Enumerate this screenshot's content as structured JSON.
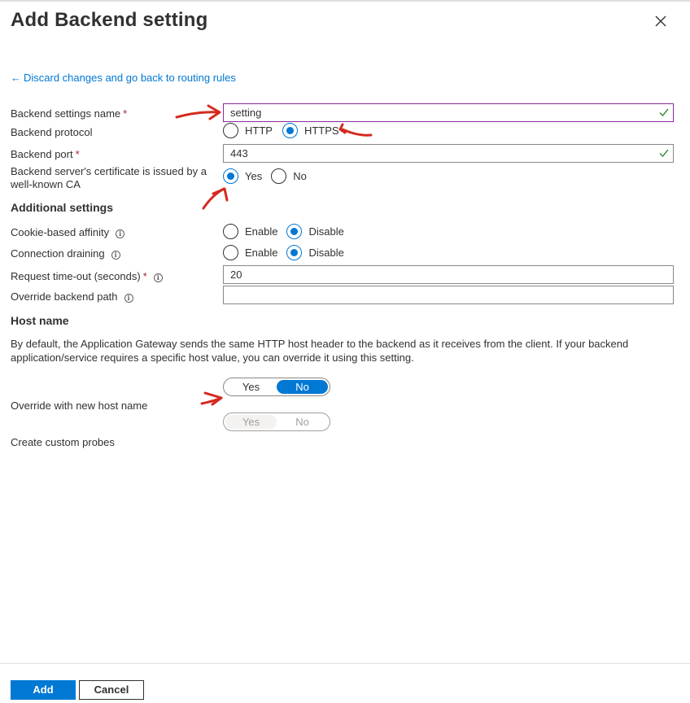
{
  "dialog": {
    "title": "Add Backend setting",
    "close_icon": "close-icon"
  },
  "back_link": {
    "arrow": "←",
    "label": "Discard changes and go back to routing rules"
  },
  "form": {
    "settings_name": {
      "label": "Backend settings name",
      "required": "*",
      "value": "setting",
      "valid": true
    },
    "protocol": {
      "label": "Backend protocol",
      "options": [
        "HTTP",
        "HTTPS"
      ],
      "selected": "HTTPS"
    },
    "port": {
      "label": "Backend port",
      "required": "*",
      "value": "443",
      "valid": true
    },
    "well_known_ca": {
      "label": "Backend server's certificate is issued by a well-known CA",
      "options": [
        "Yes",
        "No"
      ],
      "selected": "Yes"
    }
  },
  "additional": {
    "heading": "Additional settings",
    "cookie_affinity": {
      "label": "Cookie-based affinity",
      "options": [
        "Enable",
        "Disable"
      ],
      "selected": "Disable"
    },
    "connection_draining": {
      "label": "Connection draining",
      "options": [
        "Enable",
        "Disable"
      ],
      "selected": "Disable"
    },
    "timeout": {
      "label": "Request time-out (seconds)",
      "required": "*",
      "value": "20"
    },
    "override_path": {
      "label": "Override backend path",
      "value": ""
    }
  },
  "host": {
    "heading": "Host name",
    "description": "By default, the Application Gateway sends the same HTTP host header to the backend as it receives from the client. If your backend application/service requires a specific host value, you can override it using this setting.",
    "override": {
      "label": "Override with new host name",
      "options": [
        "Yes",
        "No"
      ],
      "selected": "No"
    },
    "probes": {
      "label": "Create custom probes",
      "options": [
        "Yes",
        "No"
      ],
      "selected": "Yes",
      "disabled": true
    }
  },
  "footer": {
    "add_label": "Add",
    "cancel_label": "Cancel"
  },
  "colors": {
    "accent": "#0078d4",
    "focus_border": "#8b2b9b",
    "valid_check": "#107c10",
    "annotation": "#d42a1f"
  }
}
